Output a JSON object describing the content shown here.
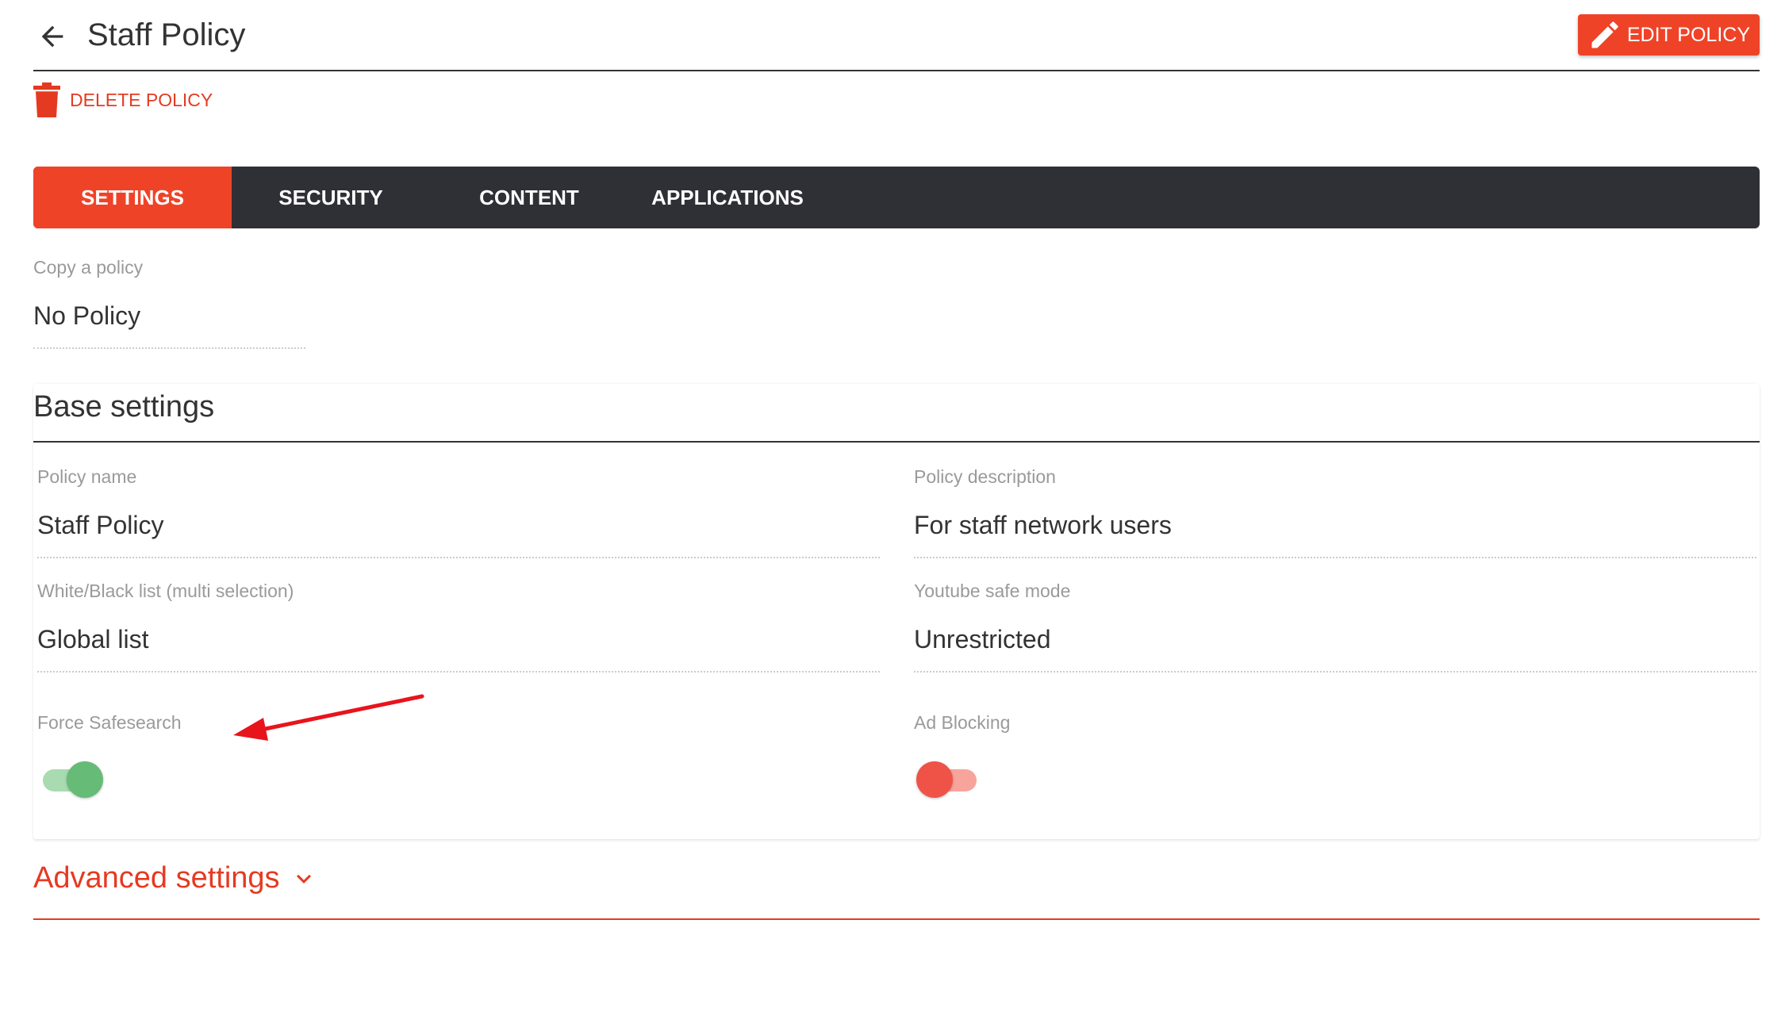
{
  "header": {
    "title": "Staff Policy",
    "back_icon": "arrow-left-icon",
    "edit_label": "EDIT POLICY",
    "edit_icon": "pencil-icon"
  },
  "actions": {
    "delete_label": "DELETE POLICY",
    "delete_icon": "trash-icon"
  },
  "tabs": [
    {
      "label": "SETTINGS",
      "active": true
    },
    {
      "label": "SECURITY",
      "active": false
    },
    {
      "label": "CONTENT",
      "active": false
    },
    {
      "label": "APPLICATIONS",
      "active": false
    }
  ],
  "copy_policy": {
    "label": "Copy a policy",
    "value": "No Policy"
  },
  "base_settings": {
    "title": "Base settings",
    "policy_name": {
      "label": "Policy name",
      "value": "Staff Policy"
    },
    "policy_description": {
      "label": "Policy description",
      "value": "For staff network users"
    },
    "list": {
      "label": "White/Black list (multi selection)",
      "value": "Global list"
    },
    "youtube": {
      "label": "Youtube safe mode",
      "value": "Unrestricted"
    },
    "force_safesearch": {
      "label": "Force Safesearch",
      "enabled": true
    },
    "ad_blocking": {
      "label": "Ad Blocking",
      "enabled": false
    }
  },
  "advanced": {
    "label": "Advanced settings",
    "icon": "chevron-down-icon"
  },
  "colors": {
    "accent": "#ef4328",
    "tab_bar": "#2f2f36",
    "toggle_on_knob": "#66bb77",
    "toggle_on_track": "#a8dbb0",
    "toggle_off_knob": "#ef5348",
    "toggle_off_track": "#f7a49c",
    "annotation": "#e8141c"
  }
}
